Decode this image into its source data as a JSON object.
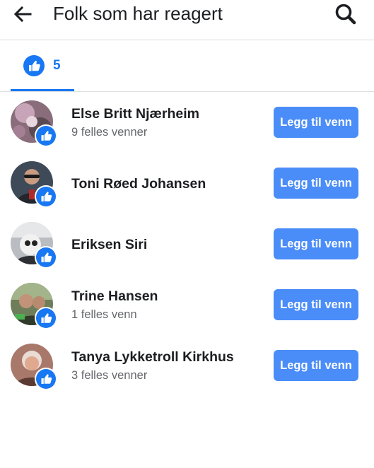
{
  "header": {
    "title": "Folk som har reagert",
    "back_icon": "arrow-left-icon",
    "search_icon": "search-icon"
  },
  "tabs": [
    {
      "icon": "like-reaction-icon",
      "count": "5",
      "selected": true
    }
  ],
  "people": [
    {
      "name": "Else Britt Njærheim",
      "mutual": "9 felles venner",
      "button": "Legg til venn",
      "reaction": "like-reaction-icon"
    },
    {
      "name": "Toni Røed Johansen",
      "mutual": "",
      "button": "Legg til venn",
      "reaction": "like-reaction-icon"
    },
    {
      "name": "Eriksen Siri",
      "mutual": "",
      "button": "Legg til venn",
      "reaction": "like-reaction-icon"
    },
    {
      "name": "Trine Hansen",
      "mutual": "1 felles venn",
      "button": "Legg til venn",
      "reaction": "like-reaction-icon"
    },
    {
      "name": "Tanya Lykketroll Kirkhus",
      "mutual": "3 felles venner",
      "button": "Legg til venn",
      "reaction": "like-reaction-icon"
    }
  ],
  "colors": {
    "accent": "#1877f2",
    "button": "#4b8df8",
    "text": "#1c1e21",
    "secondary_text": "#65676b"
  }
}
